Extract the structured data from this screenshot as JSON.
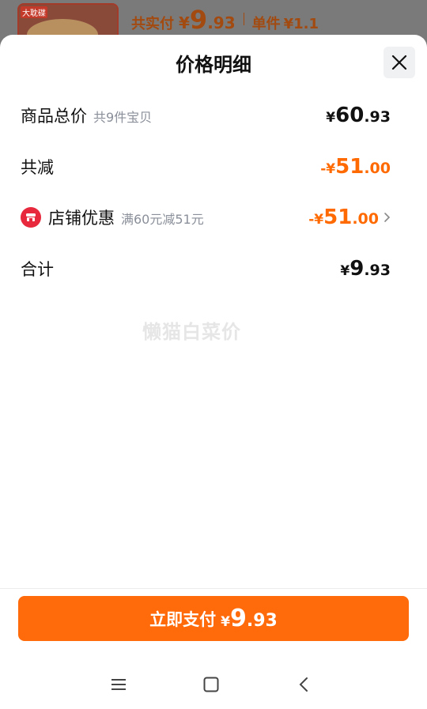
{
  "background": {
    "thumb_tag": "大耽碟",
    "total_label": "共实付",
    "total_currency": "¥",
    "total_int": "9",
    "total_dec": ".93",
    "unit_label": "单件",
    "unit_price": "¥1.1"
  },
  "sheet": {
    "title": "价格明细",
    "close_icon": "close-icon"
  },
  "rows": {
    "goods_total": {
      "label": "商品总价",
      "sub": "共9件宝贝",
      "currency": "¥",
      "int": "60",
      "dec": ".93"
    },
    "discount_total": {
      "label": "共减",
      "currency": "-¥",
      "int": "51",
      "dec": ".00"
    },
    "shop_coupon": {
      "label": "店铺优惠",
      "sub": "满60元减51元",
      "currency": "-¥",
      "int": "51",
      "dec": ".00"
    },
    "sum": {
      "label": "合计",
      "currency": "¥",
      "int": "9",
      "dec": ".93"
    }
  },
  "watermark": "懒猫白菜价",
  "pay_button": {
    "label": "立即支付",
    "currency": "¥",
    "int": "9",
    "dec": ".93"
  },
  "colors": {
    "accent": "#ff6a00",
    "shop_icon": "#e8283c"
  },
  "navbar": {
    "items": [
      "menu-icon",
      "home-icon",
      "back-icon"
    ]
  }
}
